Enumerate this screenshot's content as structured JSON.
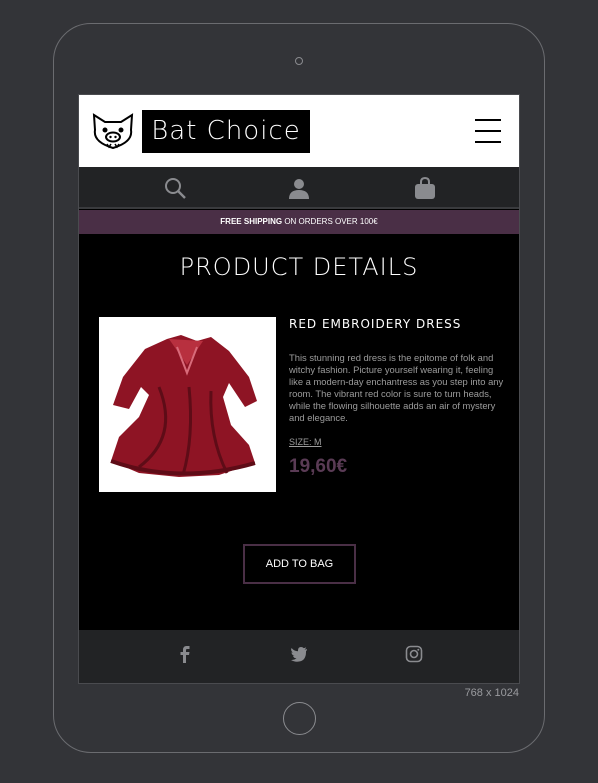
{
  "device": {
    "viewport_label": "768 x 1024"
  },
  "header": {
    "brand": "Bat Choice"
  },
  "promo": {
    "bold": "FREE SHIPPING",
    "rest": "ON ORDERS OVER 100€"
  },
  "page": {
    "title": "PRODUCT DETAILS"
  },
  "product": {
    "name": "RED EMBROIDERY DRESS",
    "description": "This stunning red dress is the epitome of folk and witchy fashion. Picture yourself wearing it, feeling like a modern-day enchantress as you step into any room. The vibrant red color is sure to turn heads, while the flowing silhouette adds an air of mystery and elegance.",
    "size": "SIZE: M",
    "price": "19,60€",
    "add_label": "ADD TO BAG"
  },
  "icons": {
    "nav": [
      "search-icon",
      "user-icon",
      "bag-icon"
    ],
    "social": [
      "facebook-icon",
      "twitter-icon",
      "instagram-icon"
    ]
  },
  "colors": {
    "accent": "#4a2f46",
    "price": "#5a3b55",
    "nav_bg": "#222325"
  }
}
